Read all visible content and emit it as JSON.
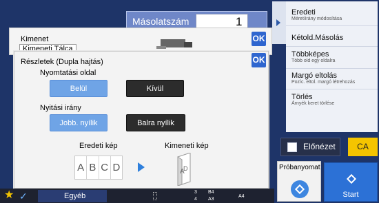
{
  "copy": {
    "label": "Másolatszám",
    "count": "1"
  },
  "background_window": {
    "line1": "Kimenet",
    "line2": "Kimeneti Tálca",
    "ok": "OK"
  },
  "dialog": {
    "title": "Részletek (Dupla hajtás)",
    "ok": "OK",
    "print_side_label": "Nyomtatási oldal",
    "print_side_options": [
      "Belül",
      "Kívül"
    ],
    "print_side_selected": "Belül",
    "opening_label": "Nyitási irány",
    "opening_options": [
      "Jobb. nyílik",
      "Balra nyílik"
    ],
    "opening_selected": "Jobb. nyílik",
    "original_label": "Eredeti kép",
    "output_label": "Kimeneti kép",
    "pages": [
      "A",
      "B",
      "C",
      "D"
    ],
    "book_letters": [
      "A",
      "D"
    ]
  },
  "right_panel": {
    "items": [
      {
        "main": "Eredeti",
        "sub": "Méret/irány módosítása"
      },
      {
        "main": "Kétold.Másolás",
        "sub": ""
      },
      {
        "main": "Többképes",
        "sub": "Több old egy oldalra"
      },
      {
        "main": "Margó eltolás",
        "sub": "Pozíc. eltol. margó létrehozás"
      },
      {
        "main": "Törlés",
        "sub": "Árnyék keret törlése"
      }
    ]
  },
  "buttons": {
    "preview": "Előnézet",
    "ca": "CA",
    "proof": "Próbanyomat",
    "start": "Start"
  },
  "bottom": {
    "other": "Egyéb",
    "trays": [
      "3",
      "B4",
      "4",
      "A3",
      "A4"
    ]
  },
  "colors": {
    "accent_blue": "#2f66cf",
    "selected": "#6fa4e6",
    "ca_yellow": "#f4c400",
    "start_blue": "#2c71d6"
  }
}
